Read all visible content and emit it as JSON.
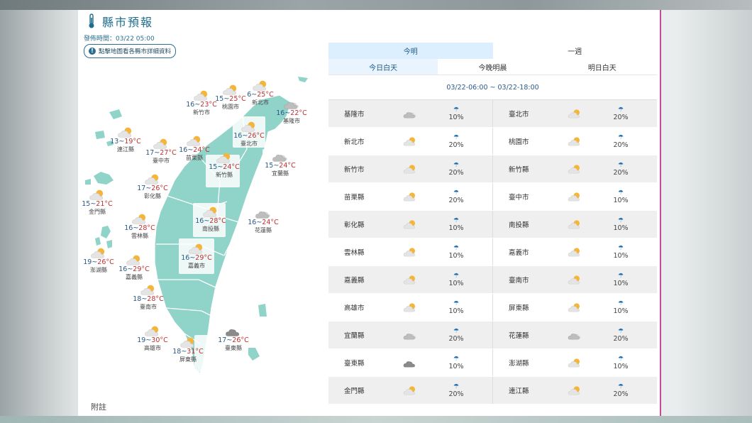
{
  "header": {
    "title": "縣市預報",
    "publish_time": "發佈時間：03/22 05:00",
    "map_hint": "點擊地圖看各縣市詳細資料",
    "footnote": "附註"
  },
  "colors": {
    "map_fill": "#8fd3c9",
    "accent": "#1d6c8f",
    "tab_active": "#dcefff",
    "temp_high": "#c03030",
    "temp_low": "#2a5a88"
  },
  "map_cities": [
    {
      "id": "keelung",
      "name": "基隆市",
      "low": "16",
      "high": "22°C",
      "icon": "cloudy-icon"
    },
    {
      "id": "taipei",
      "name": "臺北市",
      "low": "16",
      "high": "26°C",
      "icon": "partly-sunny-icon"
    },
    {
      "id": "newtaipei",
      "name": "新北市",
      "low": "6",
      "high": "25°C",
      "icon": "partly-sunny-icon"
    },
    {
      "id": "taoyuan",
      "name": "桃園市",
      "low": "15",
      "high": "25°C",
      "icon": "partly-sunny-icon"
    },
    {
      "id": "hsinchucity",
      "name": "新竹市",
      "low": "16",
      "high": "23°C",
      "icon": "partly-sunny-icon"
    },
    {
      "id": "hsinchucounty",
      "name": "新竹縣",
      "low": "15",
      "high": "24°C",
      "icon": "partly-sunny-icon"
    },
    {
      "id": "miaoli",
      "name": "苗栗縣",
      "low": "16",
      "high": "24°C",
      "icon": "partly-sunny-icon"
    },
    {
      "id": "yilan",
      "name": "宜蘭縣",
      "low": "15",
      "high": "24°C",
      "icon": "cloudy-icon"
    },
    {
      "id": "taichung",
      "name": "臺中市",
      "low": "17",
      "high": "27°C",
      "icon": "partly-sunny-icon"
    },
    {
      "id": "lienchiang",
      "name": "連江縣",
      "low": "13",
      "high": "19°C",
      "icon": "partly-sunny-icon"
    },
    {
      "id": "changhua",
      "name": "彰化縣",
      "low": "17",
      "high": "26°C",
      "icon": "partly-sunny-icon"
    },
    {
      "id": "kinmen",
      "name": "金門縣",
      "low": "15",
      "high": "21°C",
      "icon": "partly-sunny-icon"
    },
    {
      "id": "nantou",
      "name": "南投縣",
      "low": "16",
      "high": "28°C",
      "icon": "partly-sunny-icon"
    },
    {
      "id": "hualien",
      "name": "花蓮縣",
      "low": "16",
      "high": "24°C",
      "icon": "cloudy-icon"
    },
    {
      "id": "yunlin",
      "name": "雲林縣",
      "low": "16",
      "high": "28°C",
      "icon": "partly-sunny-icon"
    },
    {
      "id": "penghu",
      "name": "澎湖縣",
      "low": "19",
      "high": "26°C",
      "icon": "partly-sunny-icon"
    },
    {
      "id": "chiayicounty",
      "name": "嘉義縣",
      "low": "16",
      "high": "29°C",
      "icon": "partly-sunny-icon"
    },
    {
      "id": "chiayicity",
      "name": "嘉義市",
      "low": "16",
      "high": "29°C",
      "icon": "partly-sunny-icon"
    },
    {
      "id": "tainan",
      "name": "臺南市",
      "low": "18",
      "high": "28°C",
      "icon": "partly-sunny-icon"
    },
    {
      "id": "kaohsiung",
      "name": "高雄市",
      "low": "19",
      "high": "30°C",
      "icon": "partly-sunny-icon"
    },
    {
      "id": "taitung",
      "name": "臺東縣",
      "low": "17",
      "high": "26°C",
      "icon": "overcast-icon"
    },
    {
      "id": "pingtung",
      "name": "屏東縣",
      "low": "18",
      "high": "31°C",
      "icon": "partly-sunny-icon"
    }
  ],
  "tabs": {
    "top": [
      {
        "label": "今明",
        "active": true
      },
      {
        "label": "一週",
        "active": false
      }
    ],
    "sub": [
      {
        "label": "今日白天",
        "active": true
      },
      {
        "label": "今晚明晨",
        "active": false
      },
      {
        "label": "明日白天",
        "active": false
      }
    ]
  },
  "time_range": "03/22-06:00 ~ 03/22-18:00",
  "table_rows": [
    {
      "left": {
        "name": "基隆市",
        "icon": "cloudy-icon",
        "rain": "10%"
      },
      "right": {
        "name": "臺北市",
        "icon": "partly-sunny-icon",
        "rain": "20%"
      }
    },
    {
      "left": {
        "name": "新北市",
        "icon": "partly-sunny-icon",
        "rain": "20%"
      },
      "right": {
        "name": "桃園市",
        "icon": "partly-sunny-icon",
        "rain": "20%"
      }
    },
    {
      "left": {
        "name": "新竹市",
        "icon": "partly-sunny-icon",
        "rain": "20%"
      },
      "right": {
        "name": "新竹縣",
        "icon": "partly-sunny-icon",
        "rain": "20%"
      }
    },
    {
      "left": {
        "name": "苗栗縣",
        "icon": "partly-sunny-icon",
        "rain": "20%"
      },
      "right": {
        "name": "臺中市",
        "icon": "partly-sunny-icon",
        "rain": "10%"
      }
    },
    {
      "left": {
        "name": "彰化縣",
        "icon": "partly-sunny-icon",
        "rain": "10%"
      },
      "right": {
        "name": "南投縣",
        "icon": "partly-sunny-icon",
        "rain": "10%"
      }
    },
    {
      "left": {
        "name": "雲林縣",
        "icon": "partly-sunny-icon",
        "rain": "10%"
      },
      "right": {
        "name": "嘉義市",
        "icon": "partly-sunny-icon",
        "rain": "10%"
      }
    },
    {
      "left": {
        "name": "嘉義縣",
        "icon": "partly-sunny-icon",
        "rain": "10%"
      },
      "right": {
        "name": "臺南市",
        "icon": "partly-sunny-icon",
        "rain": "10%"
      }
    },
    {
      "left": {
        "name": "高雄市",
        "icon": "partly-sunny-icon",
        "rain": "10%"
      },
      "right": {
        "name": "屏東縣",
        "icon": "partly-sunny-icon",
        "rain": "10%"
      }
    },
    {
      "left": {
        "name": "宜蘭縣",
        "icon": "cloudy-icon",
        "rain": "20%"
      },
      "right": {
        "name": "花蓮縣",
        "icon": "cloudy-icon",
        "rain": "20%"
      }
    },
    {
      "left": {
        "name": "臺東縣",
        "icon": "overcast-icon",
        "rain": "10%"
      },
      "right": {
        "name": "澎湖縣",
        "icon": "partly-sunny-icon",
        "rain": "10%"
      }
    },
    {
      "left": {
        "name": "金門縣",
        "icon": "partly-sunny-icon",
        "rain": "20%"
      },
      "right": {
        "name": "連江縣",
        "icon": "partly-sunny-icon",
        "rain": "20%"
      }
    }
  ],
  "umbrella_glyph": "☂"
}
